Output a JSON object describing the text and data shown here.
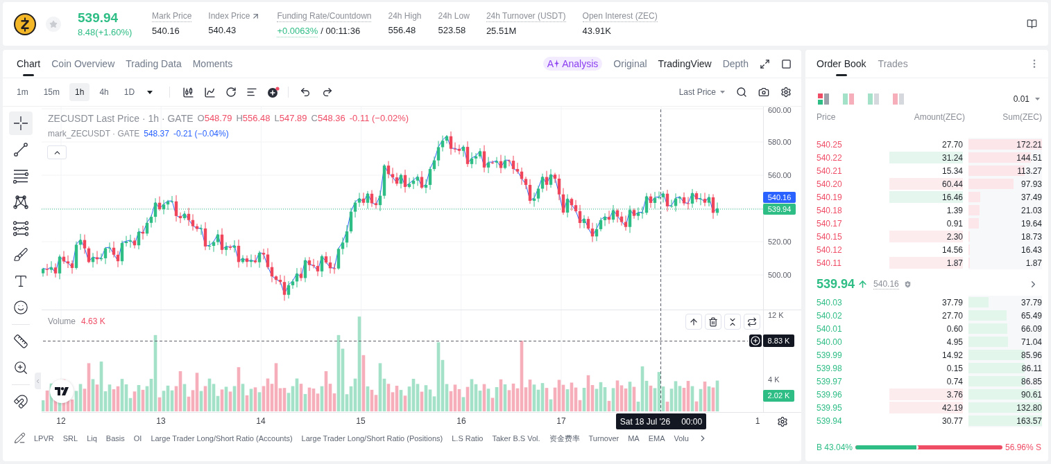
{
  "header": {
    "price": "539.94",
    "change": "8.48(+1.60%)",
    "rising": true,
    "stats": [
      {
        "label": "Mark Price",
        "dotted": true,
        "link": false,
        "values": [
          {
            "text": "540.16",
            "rising": false,
            "dotted": false
          }
        ]
      },
      {
        "label": "Index Price",
        "dotted": false,
        "link": true,
        "values": [
          {
            "text": "540.43",
            "rising": false,
            "dotted": false
          }
        ]
      },
      {
        "label": "Funding Rate/Countdown",
        "dotted": true,
        "link": false,
        "values": [
          {
            "text": "+0.0063%",
            "rising": true,
            "dotted": true
          },
          {
            "text": "/ 00:11:36",
            "rising": false,
            "dotted": false
          }
        ]
      },
      {
        "label": "24h High",
        "dotted": false,
        "link": false,
        "values": [
          {
            "text": "556.48",
            "rising": false,
            "dotted": false
          }
        ]
      },
      {
        "label": "24h Low",
        "dotted": false,
        "link": false,
        "values": [
          {
            "text": "523.58",
            "rising": false,
            "dotted": false
          }
        ]
      },
      {
        "label": "24h Turnover (USDT)",
        "dotted": true,
        "link": false,
        "values": [
          {
            "text": "25.51M",
            "rising": false,
            "dotted": false
          }
        ]
      },
      {
        "label": "Open Interest (ZEC)",
        "dotted": true,
        "link": false,
        "values": [
          {
            "text": "43.91K",
            "rising": false,
            "dotted": false
          }
        ]
      }
    ]
  },
  "chart": {
    "tabs": [
      {
        "label": "Chart",
        "selected": true
      },
      {
        "label": "Coin Overview",
        "selected": false
      },
      {
        "label": "Trading Data",
        "selected": false
      },
      {
        "label": "Moments",
        "selected": false
      }
    ],
    "views": [
      {
        "kind": "ai",
        "prefix": "A",
        "label": "Analysis",
        "selected": false
      },
      {
        "kind": "plain",
        "label": "Original",
        "selected": false
      },
      {
        "kind": "plain",
        "label": "TradingView",
        "selected": true
      },
      {
        "kind": "plain",
        "label": "Depth",
        "selected": false
      }
    ],
    "intervals": [
      {
        "label": "1m",
        "selected": false
      },
      {
        "label": "15m",
        "selected": false
      },
      {
        "label": "1h",
        "selected": true
      },
      {
        "label": "4h",
        "selected": false
      },
      {
        "label": "1D",
        "selected": false
      }
    ],
    "price_source": "Last Price",
    "tools": [
      [
        {
          "kind": "crosshair",
          "selected": true
        },
        {
          "kind": "trend_line",
          "selected": false
        },
        {
          "kind": "horizontal_lines",
          "selected": false
        },
        {
          "kind": "pattern",
          "selected": false
        },
        {
          "kind": "level_lines",
          "selected": false
        },
        {
          "kind": "brush",
          "selected": false
        },
        {
          "kind": "text",
          "selected": false
        },
        {
          "kind": "emoji",
          "selected": false
        }
      ],
      [
        {
          "kind": "ruler",
          "selected": false
        },
        {
          "kind": "zoom",
          "selected": false
        }
      ],
      [
        {
          "kind": "magnet",
          "selected": false
        }
      ]
    ],
    "legend": {
      "title": "ZECUSDT Last Price · 1h · GATE",
      "rising": false,
      "ohlc": [
        {
          "key": "O",
          "value": "548.79"
        },
        {
          "key": "H",
          "value": "556.48"
        },
        {
          "key": "L",
          "value": "547.89"
        },
        {
          "key": "C",
          "value": "548.36"
        }
      ],
      "change": "-0.11 (−0.02%)",
      "mark_title": "mark_ZECUSDT · GATE",
      "mark_value": "548.37",
      "mark_change": "-0.21 (−0.04%)"
    },
    "price_axis": [
      "600.00",
      "580.00",
      "560.00",
      "520.00",
      "500.00"
    ],
    "price_tags": [
      {
        "kind": "mark",
        "text": "540.16"
      },
      {
        "kind": "last",
        "text": "539.94"
      }
    ],
    "volume": {
      "label": "Volume",
      "value": "4.63 K",
      "axis": [
        "12 K",
        "4 K"
      ],
      "crosshair_value": "8.83 K",
      "last_value": "2.02 K"
    },
    "time_axis": [
      "12",
      "13",
      "14",
      "15",
      "16",
      "17",
      "1"
    ],
    "crosshair_time": {
      "date": "Sat 18 Jul '26",
      "time": "00:00"
    },
    "indicators": [
      "LPVR",
      "SRL",
      "Liq",
      "Basis",
      "OI",
      "Large Trader Long/Short Ratio (Accounts)",
      "Large Trader Long/Short Ratio (Positions)",
      "L.S Ratio",
      "Taker B.S Vol.",
      "资金费率",
      "Turnover",
      "MA",
      "EMA",
      "Volu"
    ]
  },
  "order_book": {
    "tabs": [
      {
        "label": "Order Book",
        "selected": true
      },
      {
        "label": "Trades",
        "selected": false
      }
    ],
    "precision": "0.01",
    "columns": [
      "Price",
      "Amount(ZEC)",
      "Sum(ZEC)"
    ],
    "asks": [
      {
        "price": "540.25",
        "amount": "27.70",
        "sum": "172.21",
        "level": 1.0,
        "kind": "plain"
      },
      {
        "price": "540.22",
        "amount": "31.24",
        "sum": "144.51",
        "level": 0.85,
        "kind": "buy_flash"
      },
      {
        "price": "540.21",
        "amount": "15.34",
        "sum": "113.27",
        "level": 0.76,
        "kind": "plain"
      },
      {
        "price": "540.20",
        "amount": "60.44",
        "sum": "97.93",
        "level": 0.61,
        "kind": "sell_flash"
      },
      {
        "price": "540.19",
        "amount": "16.46",
        "sum": "37.49",
        "level": 0.16,
        "kind": "buy_flash"
      },
      {
        "price": "540.18",
        "amount": "1.39",
        "sum": "21.03",
        "level": 0.15,
        "kind": "plain"
      },
      {
        "price": "540.17",
        "amount": "0.91",
        "sum": "19.64",
        "level": 0.14,
        "kind": "plain"
      },
      {
        "price": "540.15",
        "amount": "2.30",
        "sum": "18.73",
        "level": 0.02,
        "kind": "sell_flash"
      },
      {
        "price": "540.12",
        "amount": "14.56",
        "sum": "16.43",
        "level": 0.02,
        "kind": "plain"
      },
      {
        "price": "540.11",
        "amount": "1.87",
        "sum": "1.87",
        "level": 0.02,
        "kind": "sell_flash"
      }
    ],
    "last_price": "539.94",
    "rising": true,
    "mark_price": "540.16",
    "bids": [
      {
        "price": "540.03",
        "amount": "37.79",
        "sum": "37.79",
        "level": 0.27,
        "kind": "plain"
      },
      {
        "price": "540.02",
        "amount": "27.70",
        "sum": "65.49",
        "level": 0.52,
        "kind": "plain"
      },
      {
        "price": "540.01",
        "amount": "0.60",
        "sum": "66.09",
        "level": 0.53,
        "kind": "plain"
      },
      {
        "price": "540.00",
        "amount": "4.95",
        "sum": "71.04",
        "level": 0.54,
        "kind": "plain"
      },
      {
        "price": "539.99",
        "amount": "14.92",
        "sum": "85.96",
        "level": 0.76,
        "kind": "plain"
      },
      {
        "price": "539.98",
        "amount": "0.15",
        "sum": "86.11",
        "level": 0.76,
        "kind": "plain"
      },
      {
        "price": "539.97",
        "amount": "0.74",
        "sum": "86.85",
        "level": 0.77,
        "kind": "plain"
      },
      {
        "price": "539.96",
        "amount": "3.76",
        "sum": "90.61",
        "level": 0.96,
        "kind": "sell_flash"
      },
      {
        "price": "539.95",
        "amount": "42.19",
        "sum": "132.80",
        "level": 1.0,
        "kind": "sell_flash"
      },
      {
        "price": "539.94",
        "amount": "30.77",
        "sum": "163.57",
        "level": 1.0,
        "kind": "plain"
      }
    ],
    "ratio": {
      "buy": "B 43.04%",
      "sell": "56.96% S",
      "level": 0.4304
    }
  }
}
